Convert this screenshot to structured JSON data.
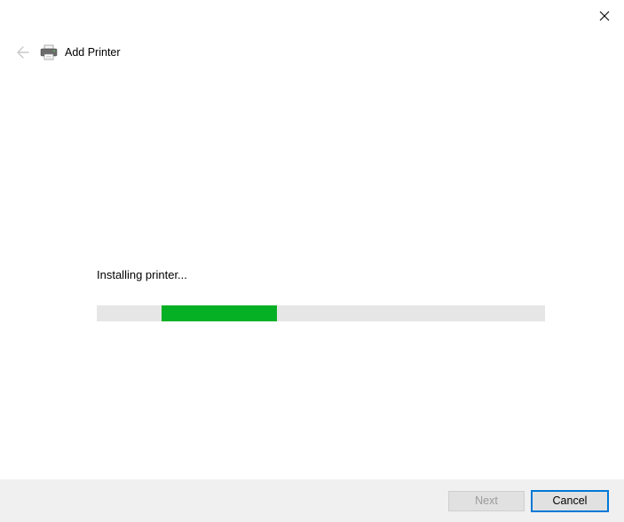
{
  "window": {
    "title": "Add Printer"
  },
  "content": {
    "status": "Installing printer..."
  },
  "footer": {
    "next_label": "Next",
    "cancel_label": "Cancel"
  },
  "progress": {
    "indeterminate": true,
    "chunk_left_pct": 14.5,
    "chunk_width_pct": 25.7
  }
}
